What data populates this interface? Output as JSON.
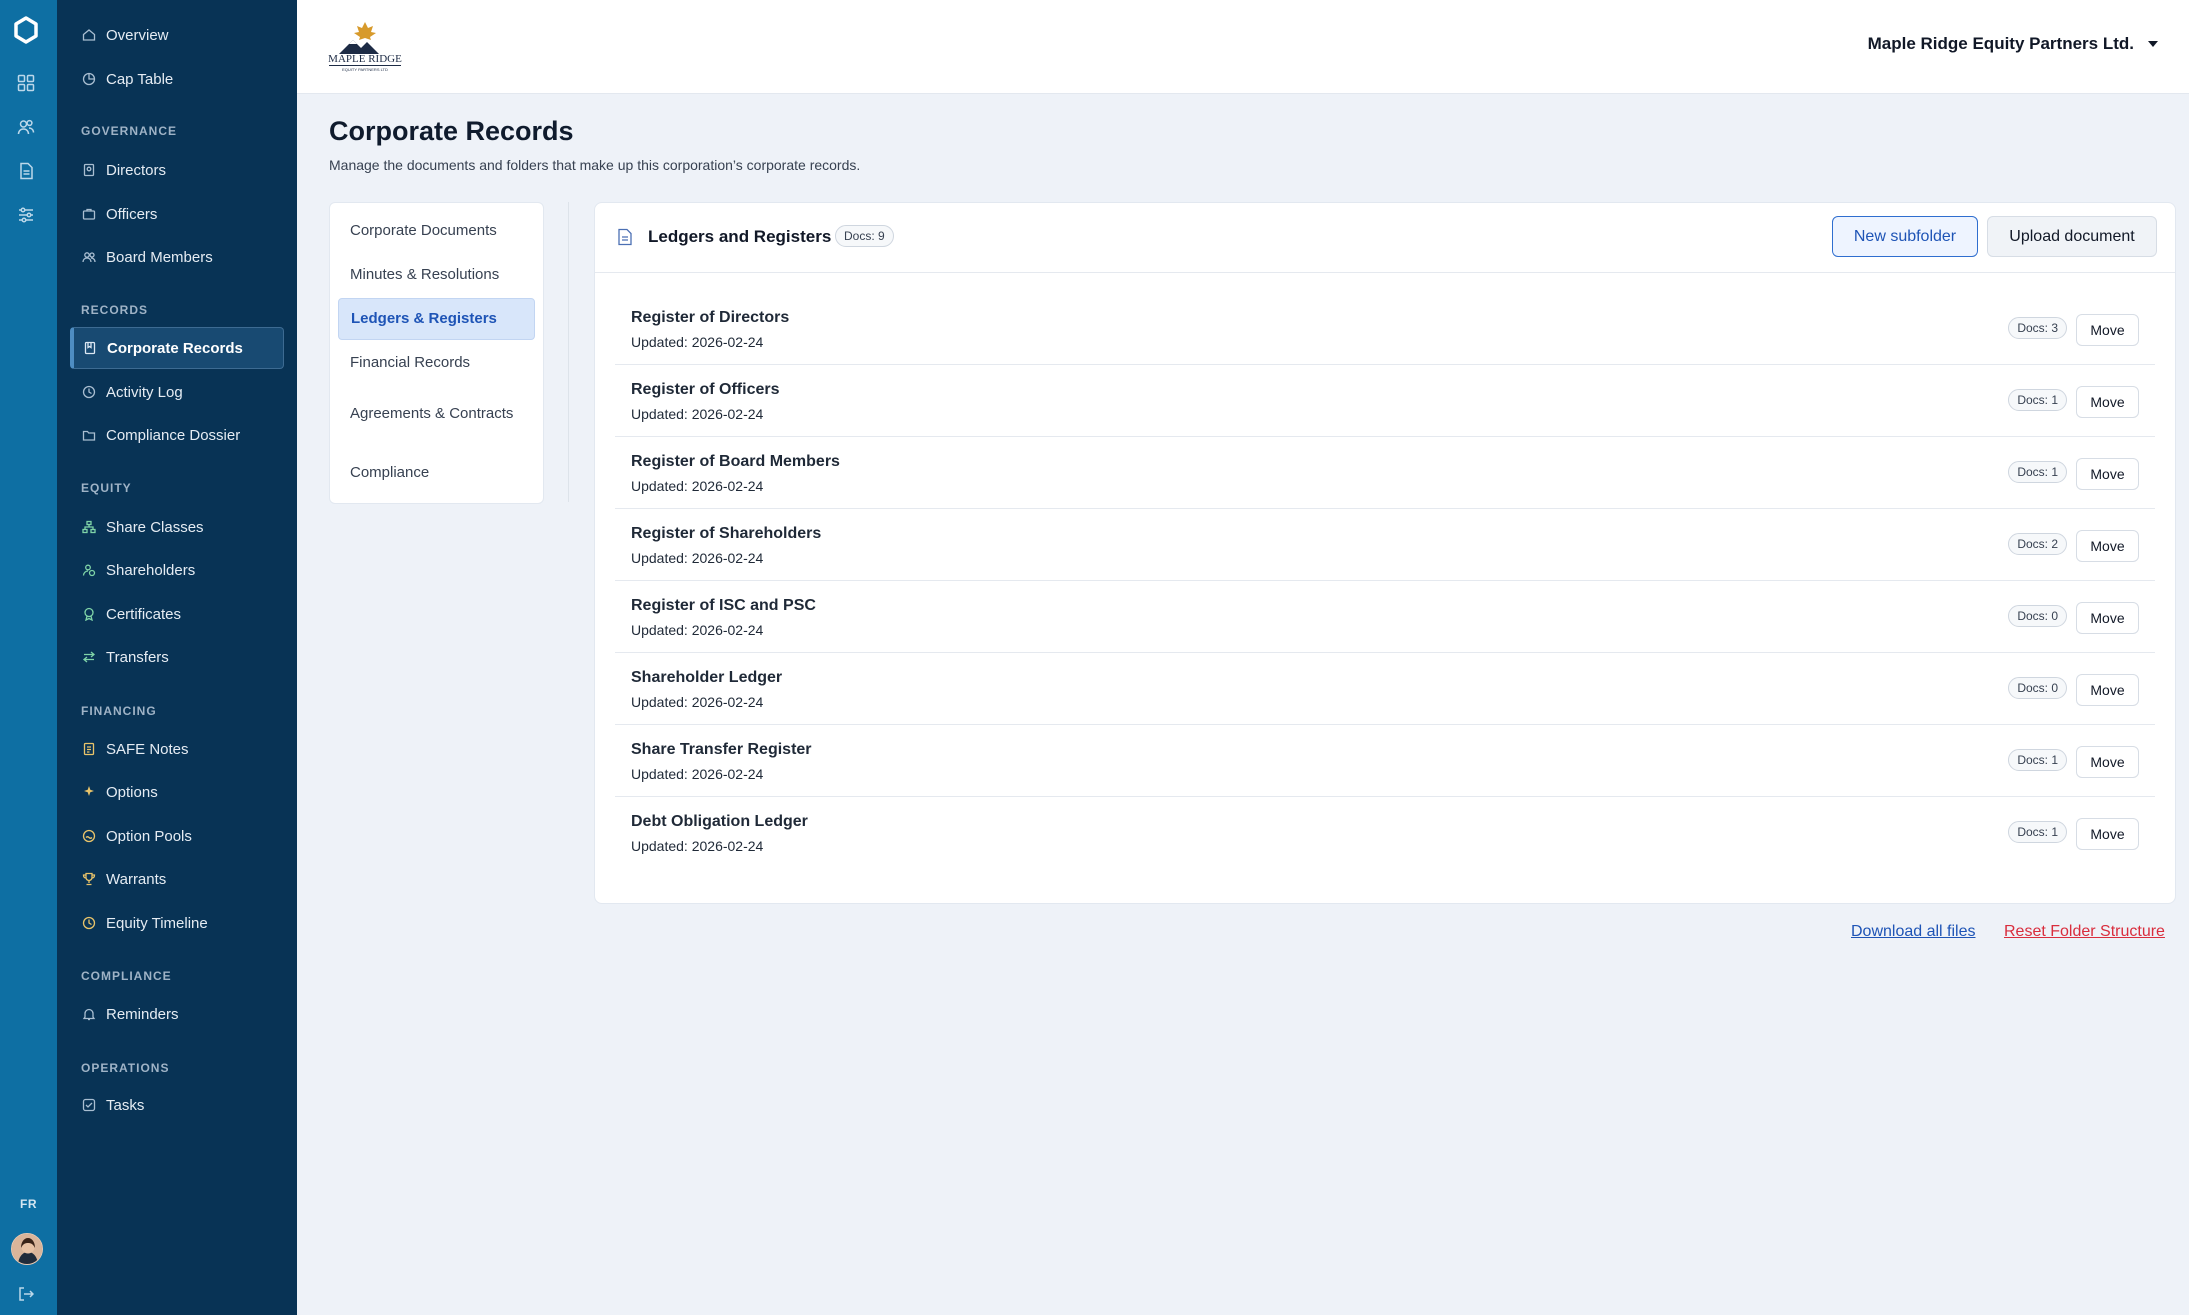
{
  "rail": {
    "icons": [
      "app-logo-icon",
      "dashboard-grid-icon",
      "users-icon",
      "document-icon",
      "sliders-icon"
    ],
    "language": "FR"
  },
  "sidebar": {
    "top_items": [
      {
        "label": "Overview",
        "icon": "home-icon"
      },
      {
        "label": "Cap Table",
        "icon": "pie-chart-icon"
      }
    ],
    "sections": [
      {
        "title": "GOVERNANCE",
        "items": [
          {
            "label": "Directors",
            "icon": "id-badge-icon"
          },
          {
            "label": "Officers",
            "icon": "briefcase-icon"
          },
          {
            "label": "Board Members",
            "icon": "people-icon"
          }
        ]
      },
      {
        "title": "RECORDS",
        "items": [
          {
            "label": "Corporate Records",
            "icon": "book-icon",
            "active": true
          },
          {
            "label": "Activity Log",
            "icon": "clock-icon"
          },
          {
            "label": "Compliance Dossier",
            "icon": "folder-icon"
          }
        ]
      },
      {
        "title": "EQUITY",
        "items": [
          {
            "label": "Share Classes",
            "icon": "hierarchy-icon"
          },
          {
            "label": "Shareholders",
            "icon": "user-group-icon"
          },
          {
            "label": "Certificates",
            "icon": "award-icon"
          },
          {
            "label": "Transfers",
            "icon": "arrows-swap-icon"
          }
        ]
      },
      {
        "title": "FINANCING",
        "items": [
          {
            "label": "SAFE Notes",
            "icon": "note-icon"
          },
          {
            "label": "Options",
            "icon": "sparkle-icon"
          },
          {
            "label": "Option Pools",
            "icon": "pool-icon"
          },
          {
            "label": "Warrants",
            "icon": "trophy-icon"
          },
          {
            "label": "Equity Timeline",
            "icon": "timeline-icon"
          }
        ]
      },
      {
        "title": "COMPLIANCE",
        "items": [
          {
            "label": "Reminders",
            "icon": "bell-icon"
          }
        ]
      },
      {
        "title": "OPERATIONS",
        "items": [
          {
            "label": "Tasks",
            "icon": "checkbox-icon"
          }
        ]
      }
    ]
  },
  "topbar": {
    "logo_text": "MAPLE RIDGE",
    "logo_subtext": "EQUITY PARTNERS LTD",
    "company_name": "Maple Ridge Equity Partners Ltd."
  },
  "page": {
    "title": "Corporate Records",
    "subtitle": "Manage the documents and folders that make up this corporation’s corporate records."
  },
  "folders": [
    {
      "label": "Corporate Documents"
    },
    {
      "label": "Minutes & Resolutions"
    },
    {
      "label": "Ledgers & Registers",
      "active": true
    },
    {
      "label": "Financial Records"
    },
    {
      "label": "Agreements & Contracts"
    },
    {
      "label": "Compliance"
    }
  ],
  "panel": {
    "title": "Ledgers and Registers",
    "docs_badge": "Docs: 9",
    "new_subfolder_label": "New subfolder",
    "upload_label": "Upload document",
    "move_label": "Move",
    "rows": [
      {
        "name": "Register of Directors",
        "updated": "Updated: 2026-02-24",
        "docs": "Docs: 3"
      },
      {
        "name": "Register of Officers",
        "updated": "Updated: 2026-02-24",
        "docs": "Docs: 1"
      },
      {
        "name": "Register of Board Members",
        "updated": "Updated: 2026-02-24",
        "docs": "Docs: 1"
      },
      {
        "name": "Register of Shareholders",
        "updated": "Updated: 2026-02-24",
        "docs": "Docs: 2"
      },
      {
        "name": "Register of ISC and PSC",
        "updated": "Updated: 2026-02-24",
        "docs": "Docs: 0"
      },
      {
        "name": "Shareholder Ledger",
        "updated": "Updated: 2026-02-24",
        "docs": "Docs: 0"
      },
      {
        "name": "Share Transfer Register",
        "updated": "Updated: 2026-02-24",
        "docs": "Docs: 1"
      },
      {
        "name": "Debt Obligation Ledger",
        "updated": "Updated: 2026-02-24",
        "docs": "Docs: 1"
      }
    ]
  },
  "footer_links": {
    "download_all": "Download all files",
    "reset_structure": "Reset Folder Structure"
  },
  "colors": {
    "rail": "#0e6fa3",
    "sidebar": "#083355",
    "accent": "#1e54b6",
    "danger": "#d92d3d",
    "background": "#eef2f8"
  }
}
